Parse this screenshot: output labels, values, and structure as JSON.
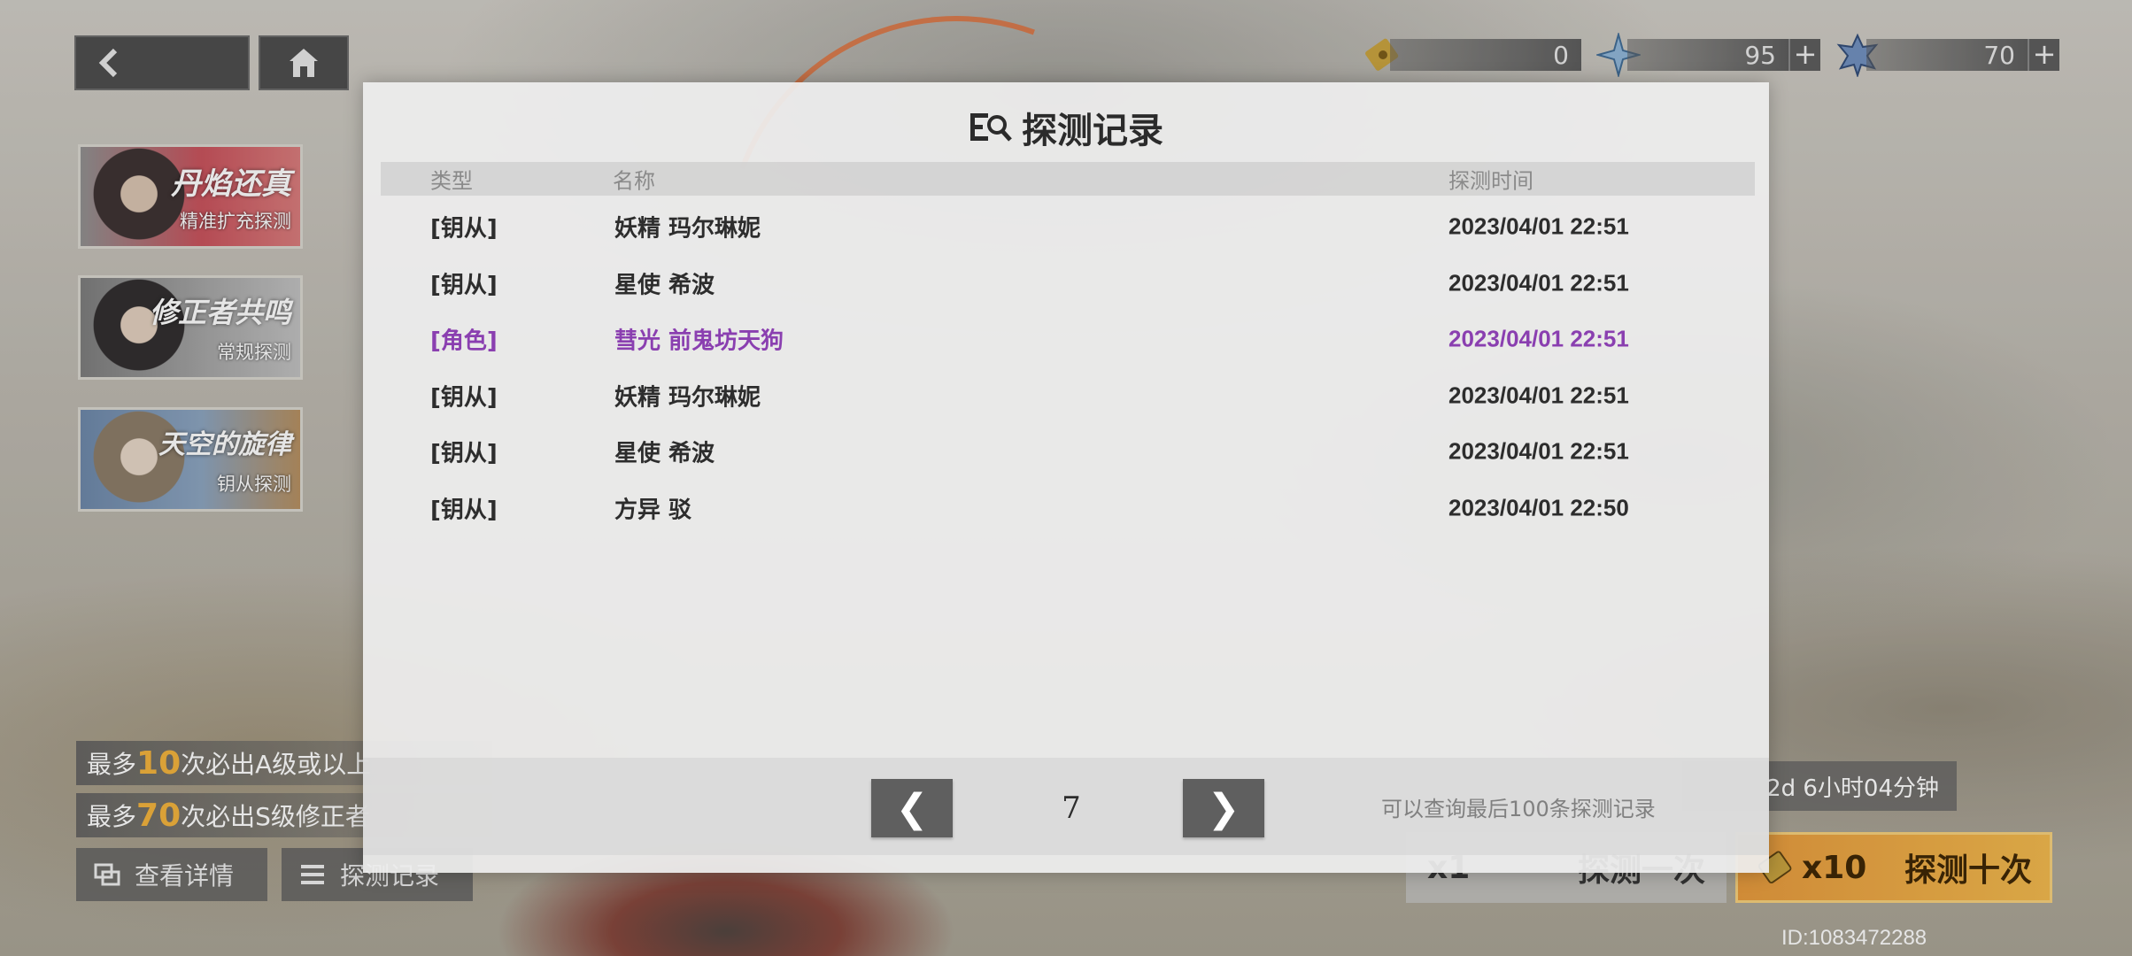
{
  "nav": {
    "back_icon": "chevron-left-icon",
    "home_icon": "home-icon"
  },
  "currencies": [
    {
      "icon": "ticket-icon",
      "value": "0"
    },
    {
      "icon": "crystal-icon",
      "value": "95"
    },
    {
      "icon": "dark-crystal-icon",
      "value": "70"
    }
  ],
  "banners": [
    {
      "title": "丹焰还真",
      "subtitle": "精准扩充探测"
    },
    {
      "title": "修正者共鸣",
      "subtitle": "常规探测"
    },
    {
      "title": "天空的旋律",
      "subtitle": "钥从探测"
    }
  ],
  "info": {
    "line1_prefix": "最多",
    "line1_num": "10",
    "line1_suffix": "次必出A级或以上",
    "line2_prefix": "最多",
    "line2_num": "70",
    "line2_suffix": "次必出S级修正者"
  },
  "bottom_buttons": {
    "details": "查看详情",
    "records": "探测记录"
  },
  "timer": "2d 6小时04分钟",
  "pull": {
    "one_count": "x1",
    "one_label": "探测一次",
    "ten_count": "x10",
    "ten_label": "探测十次"
  },
  "uid": "ID:1083472288",
  "modal": {
    "title": "探测记录",
    "columns": {
      "type": "类型",
      "name": "名称",
      "time": "探测时间"
    },
    "rows": [
      {
        "type": "[钥从]",
        "name": "妖精 玛尔琳妮",
        "time": "2023/04/01 22:51"
      },
      {
        "type": "[钥从]",
        "name": "星使 希波",
        "time": "2023/04/01 22:51"
      },
      {
        "type": "[角色]",
        "name": "彗光 前鬼坊天狗",
        "time": "2023/04/01 22:51"
      },
      {
        "type": "[钥从]",
        "name": "妖精 玛尔琳妮",
        "time": "2023/04/01 22:51"
      },
      {
        "type": "[钥从]",
        "name": "星使 希波",
        "time": "2023/04/01 22:51"
      },
      {
        "type": "[钥从]",
        "name": "方异 驳",
        "time": "2023/04/01 22:50"
      }
    ],
    "page": "7",
    "prev_label": "❮",
    "next_label": "❯",
    "note": "可以查询最后100条探测记录",
    "highlight_color": "#8a3fb0"
  }
}
